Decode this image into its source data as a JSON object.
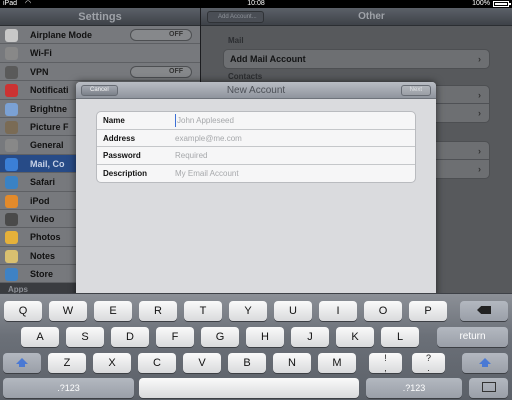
{
  "status_bar": {
    "device": "iPad",
    "time": "10:08",
    "battery": "100%",
    "battery_level": 1.0
  },
  "settings": {
    "title": "Settings",
    "rows": [
      {
        "label": "Airplane Mode",
        "toggle": "OFF"
      },
      {
        "label": "Wi-Fi"
      },
      {
        "label": "VPN",
        "toggle": "OFF"
      },
      {
        "label": "Notificati"
      },
      {
        "label": "Brightne"
      },
      {
        "label": "Picture F"
      },
      {
        "label": "General"
      },
      {
        "label": "Mail, Co",
        "selected": true
      },
      {
        "label": "Safari"
      },
      {
        "label": "iPod"
      },
      {
        "label": "Video"
      },
      {
        "label": "Photos"
      },
      {
        "label": "Notes"
      },
      {
        "label": "Store"
      }
    ],
    "apps_header": "Apps",
    "icon_colors": [
      "#c8c8c8",
      "#888",
      "#5a5a5a",
      "#c33",
      "#7ba1d4",
      "#7a6b55",
      "#888",
      "#3b7fd6",
      "#3a82c4",
      "#e28a2b",
      "#4a4a4a",
      "#e6b13a",
      "#d9c070",
      "#3f82c4"
    ]
  },
  "detail": {
    "back_label": "Add Account...",
    "title": "Other",
    "mail_header": "Mail",
    "add_mail_account": "Add Mail Account",
    "contacts_header": "Contacts"
  },
  "modal": {
    "cancel": "Cancel",
    "title": "New Account",
    "next": "Next",
    "fields": [
      {
        "label": "Name",
        "placeholder": "John Appleseed",
        "value": ""
      },
      {
        "label": "Address",
        "placeholder": "example@me.com",
        "value": ""
      },
      {
        "label": "Password",
        "placeholder": "Required",
        "value": ""
      },
      {
        "label": "Description",
        "placeholder": "My Email Account",
        "value": ""
      }
    ]
  },
  "keyboard": {
    "row1": [
      "Q",
      "W",
      "E",
      "R",
      "T",
      "Y",
      "U",
      "I",
      "O",
      "P"
    ],
    "row2": [
      "A",
      "S",
      "D",
      "F",
      "G",
      "H",
      "J",
      "K",
      "L"
    ],
    "row3": [
      "Z",
      "X",
      "C",
      "V",
      "B",
      "N",
      "M"
    ],
    "return": "return",
    "mode": ".?123",
    "exclaim": [
      "!",
      ","
    ],
    "question": [
      "?",
      "."
    ]
  }
}
